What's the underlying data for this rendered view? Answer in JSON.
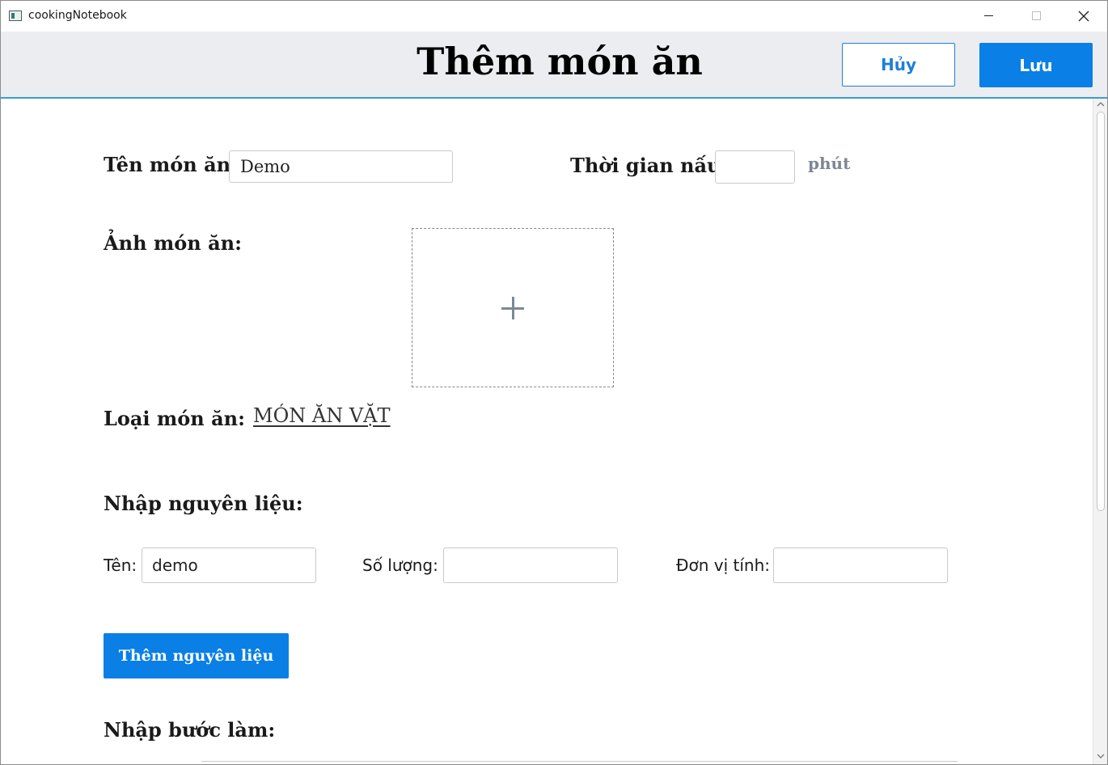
{
  "window": {
    "title": "cookingNotebook"
  },
  "header": {
    "title": "Thêm món ăn",
    "cancel_label": "Hủy",
    "save_label": "Lưu"
  },
  "form": {
    "dish_name_label": "Tên món ăn:",
    "dish_name_value": "Demo",
    "cook_time_label": "Thời gian nấu:",
    "cook_time_value": "",
    "cook_time_unit": "phút",
    "image_label": "Ảnh món ăn:",
    "category_label": "Loại món ăn:",
    "category_value": "MÓN ĂN VẶT",
    "ingredients_heading": "Nhập nguyên liệu:",
    "ingredient_name_label": "Tên:",
    "ingredient_name_value": "demo",
    "quantity_label": "Số lượng:",
    "quantity_value": "",
    "unit_label": "Đơn vị tính:",
    "unit_value": "",
    "add_ingredient_label": "Thêm nguyên liệu",
    "steps_heading": "Nhập bước làm:"
  },
  "colors": {
    "accent": "#0a7fe6",
    "header_bg": "#ecedf0",
    "header_border": "#3a9bd8",
    "muted_text": "#7d8794"
  }
}
